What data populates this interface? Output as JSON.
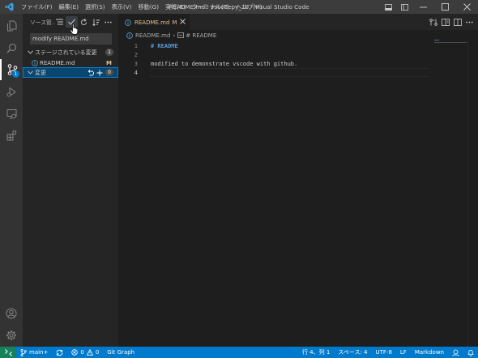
{
  "titlebar": {
    "menu": [
      "ファイル(F)",
      "編集(E)",
      "選択(S)",
      "表示(V)",
      "移動(G)",
      "実行(R)",
      "ターミナル(T)",
      "ヘルプ(H)"
    ],
    "window_title": "README.md - vscodepy_19 - Visual Studio Code"
  },
  "activitybar": {
    "items": [
      "files-icon",
      "search-icon",
      "source-control-icon",
      "run-debug-icon",
      "remote-explorer-icon",
      "extensions-icon"
    ],
    "source_control_badge": "1",
    "bottom": [
      "account-icon",
      "settings-gear-icon"
    ]
  },
  "sidebar": {
    "title": "ソース管...",
    "commit_message": "modify README.md",
    "staged_section": {
      "label": "ステージされている変更",
      "count": "1"
    },
    "staged_files": [
      {
        "name": "README.md",
        "status": "M"
      }
    ],
    "changes_section": {
      "label": "変更",
      "count": "0"
    }
  },
  "editor": {
    "tab": {
      "name": "README.md",
      "status": "M"
    },
    "breadcrumb": {
      "file": "README.md",
      "symbol": "# README"
    },
    "lines": [
      {
        "num": "1",
        "text": "# README"
      },
      {
        "num": "2",
        "text": ""
      },
      {
        "num": "3",
        "text": "modified to demonstrate vscode with github."
      },
      {
        "num": "4",
        "text": ""
      }
    ]
  },
  "statusbar": {
    "branch": "main+",
    "errors": "0",
    "warnings": "0",
    "git_graph": "Git Graph",
    "cursor_pos": "行 4、列 1",
    "spaces": "スペース: 4",
    "encoding": "UTF-8",
    "eol": "LF",
    "language": "Markdown"
  },
  "colors": {
    "accent": "#007acc",
    "modified": "#e2c08d",
    "heading": "#569cd6"
  }
}
